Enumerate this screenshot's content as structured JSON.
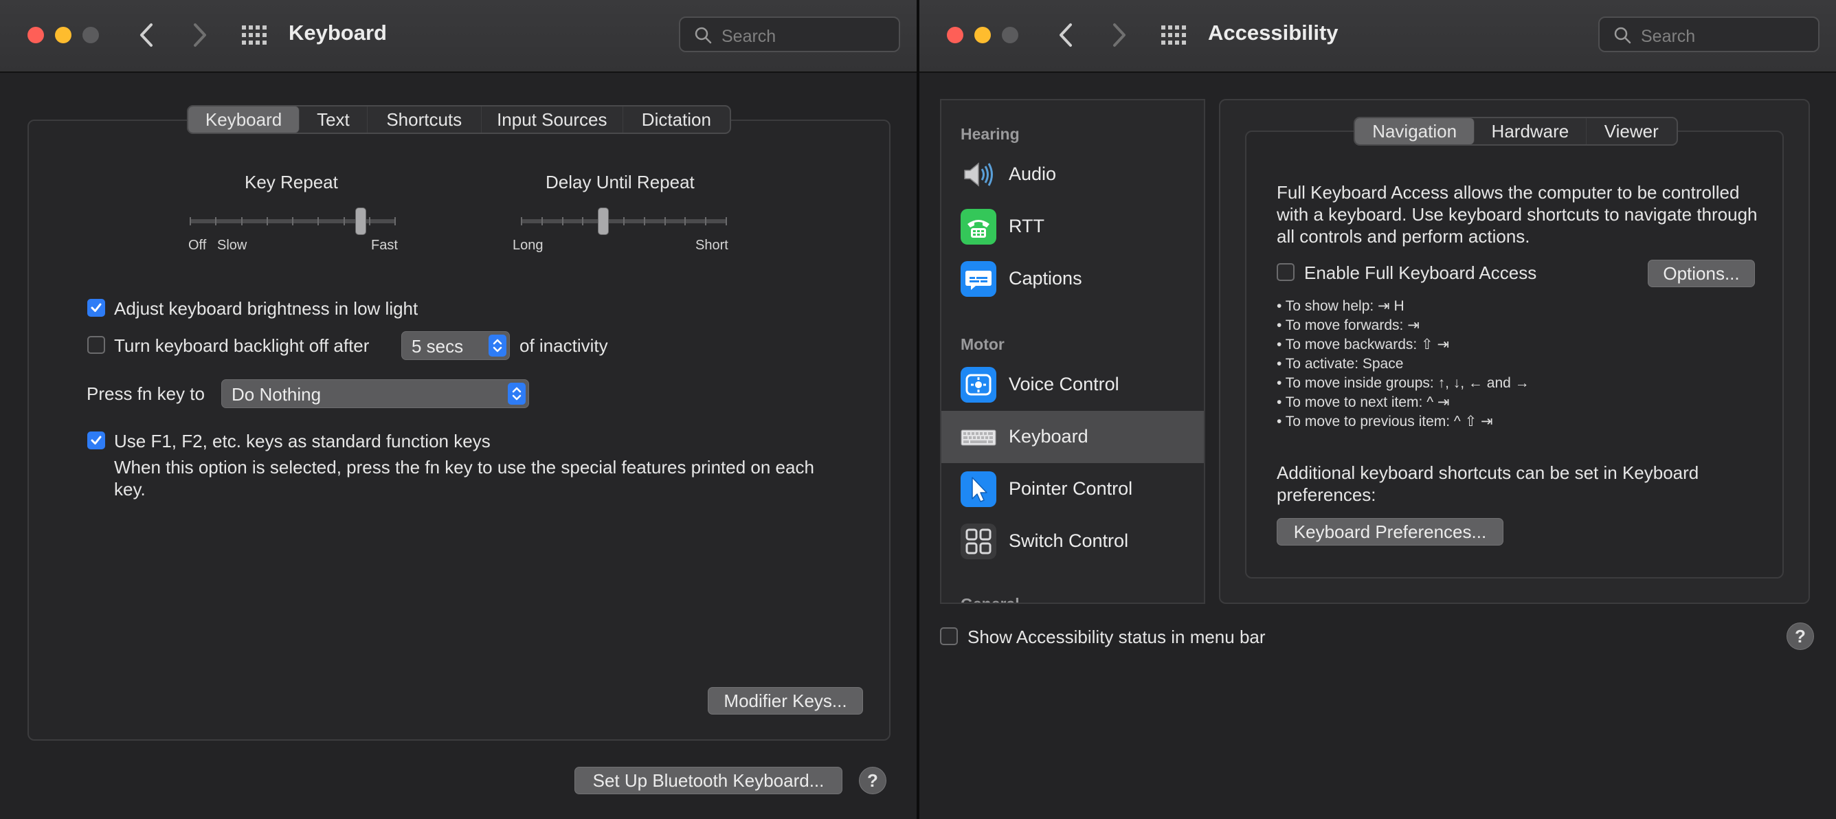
{
  "keyboard_window": {
    "title": "Keyboard",
    "search_placeholder": "Search",
    "tabs": [
      "Keyboard",
      "Text",
      "Shortcuts",
      "Input Sources",
      "Dictation"
    ],
    "active_tab": "Keyboard",
    "key_repeat": {
      "label": "Key Repeat",
      "left_label_1": "Off",
      "left_label_2": "Slow",
      "right_label": "Fast",
      "value_fraction": 0.83
    },
    "delay_until_repeat": {
      "label": "Delay Until Repeat",
      "left_label": "Long",
      "right_label": "Short",
      "value_fraction": 0.4
    },
    "adjust_brightness": {
      "label": "Adjust keyboard brightness in low light",
      "checked": true
    },
    "backlight_off": {
      "label": "Turn keyboard backlight off after",
      "checked": false,
      "value": "5 secs",
      "suffix": "of inactivity"
    },
    "fn_key": {
      "label": "Press fn key to",
      "value": "Do Nothing"
    },
    "function_keys": {
      "label": "Use F1, F2, etc. keys as standard function keys",
      "checked": true,
      "description": "When this option is selected, press the fn key to use the special features printed on each key."
    },
    "modifier_keys_button": "Modifier Keys...",
    "bluetooth_button": "Set Up Bluetooth Keyboard...",
    "help_label": "?"
  },
  "accessibility_window": {
    "title": "Accessibility",
    "search_placeholder": "Search",
    "sidebar": {
      "sections": [
        {
          "header": "Hearing",
          "items": [
            {
              "label": "Audio",
              "icon": "speaker-icon"
            },
            {
              "label": "RTT",
              "icon": "telephone-icon"
            },
            {
              "label": "Captions",
              "icon": "captions-icon"
            }
          ]
        },
        {
          "header": "Motor",
          "items": [
            {
              "label": "Voice Control",
              "icon": "voice-control-icon"
            },
            {
              "label": "Keyboard",
              "icon": "keyboard-icon",
              "selected": true
            },
            {
              "label": "Pointer Control",
              "icon": "pointer-icon"
            },
            {
              "label": "Switch Control",
              "icon": "switch-control-icon"
            }
          ]
        }
      ],
      "partial_header": "General"
    },
    "tabs": [
      "Navigation",
      "Hardware",
      "Viewer"
    ],
    "active_tab": "Navigation",
    "intro": "Full Keyboard Access allows the computer to be controlled with a keyboard. Use keyboard shortcuts to navigate through all controls and perform actions.",
    "enable_fka": {
      "label": "Enable Full Keyboard Access",
      "checked": false
    },
    "options_button": "Options...",
    "shortcuts": [
      "• To show help: ⇥ H",
      "• To move forwards: ⇥",
      "• To move backwards: ⇧ ⇥",
      "• To activate: Space",
      "• To move inside groups: ↑, ↓, ← and →",
      "• To move to next item: ^ ⇥",
      "• To move to previous item: ^ ⇧ ⇥"
    ],
    "additional_text": "Additional keyboard shortcuts can be set in Keyboard preferences:",
    "keyboard_prefs_button": "Keyboard Preferences...",
    "status_in_menu_bar": {
      "label": "Show Accessibility status in menu bar",
      "checked": false
    },
    "help_label": "?"
  },
  "colors": {
    "accent": "#2e7cf6",
    "close": "#fe5f57",
    "minimize": "#febc2e"
  }
}
